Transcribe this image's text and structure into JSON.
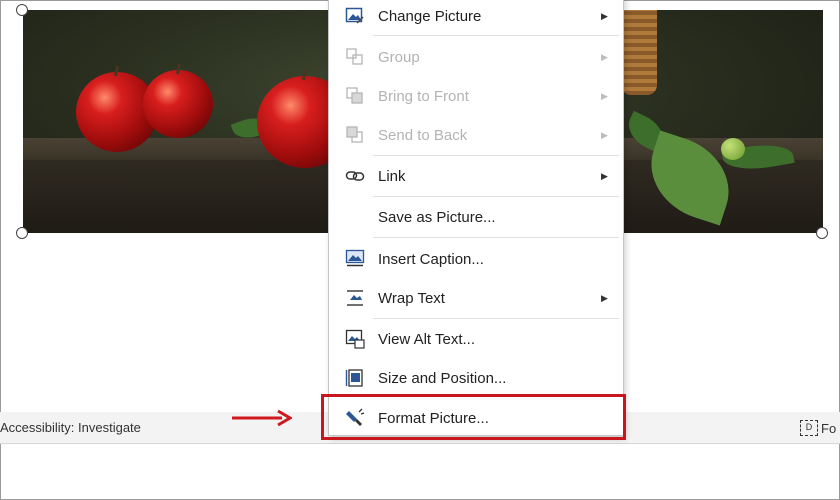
{
  "menu": {
    "items": [
      {
        "label": "Change Picture",
        "icon": "change-picture-icon",
        "submenu": true,
        "disabled": false
      },
      {
        "label": "Group",
        "icon": "group-icon",
        "submenu": true,
        "disabled": true
      },
      {
        "label": "Bring to Front",
        "icon": "bring-to-front-icon",
        "submenu": true,
        "disabled": true
      },
      {
        "label": "Send to Back",
        "icon": "send-to-back-icon",
        "submenu": true,
        "disabled": true
      },
      {
        "label": "Link",
        "icon": "link-icon",
        "submenu": true,
        "disabled": false
      },
      {
        "label": "Save as Picture...",
        "icon": "",
        "submenu": false,
        "disabled": false
      },
      {
        "label": "Insert Caption...",
        "icon": "insert-caption-icon",
        "submenu": false,
        "disabled": false
      },
      {
        "label": "Wrap Text",
        "icon": "wrap-text-icon",
        "submenu": true,
        "disabled": false
      },
      {
        "label": "View Alt Text...",
        "icon": "alt-text-icon",
        "submenu": false,
        "disabled": false
      },
      {
        "label": "Size and Position...",
        "icon": "size-position-icon",
        "submenu": false,
        "disabled": false
      },
      {
        "label": "Format Picture...",
        "icon": "format-picture-icon",
        "submenu": false,
        "disabled": false
      }
    ],
    "submenu_glyph": "▶"
  },
  "statusbar": {
    "accessibility": "Accessibility: Investigate",
    "focus_label": "Fo"
  },
  "highlight": {
    "target": "Format Picture...",
    "color": "#c8161e"
  }
}
